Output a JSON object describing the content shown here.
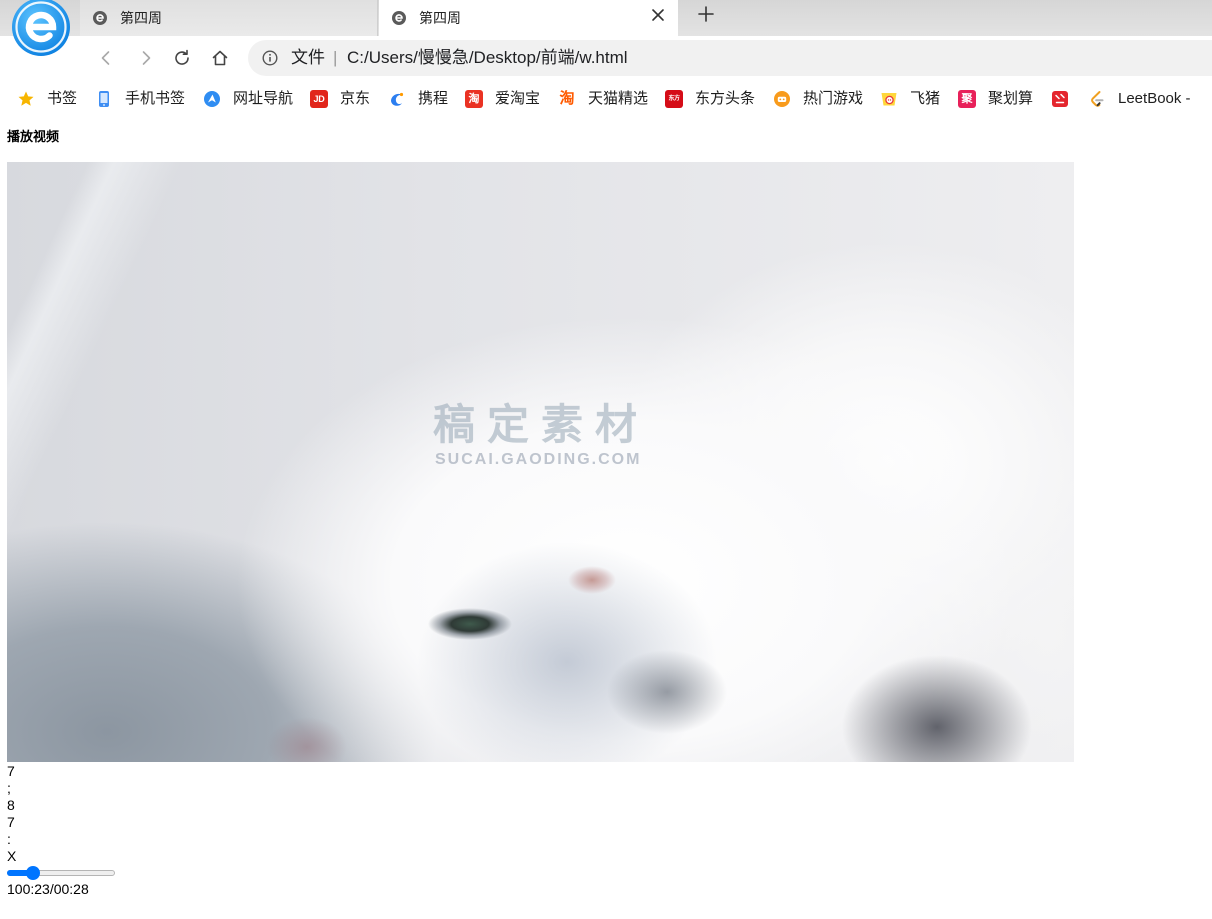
{
  "browser": {
    "logo": {
      "icon": "browser-logo-icon",
      "color": "#1890f0"
    },
    "tabs": [
      {
        "title": "第四周",
        "icon": "page-icon",
        "active": false
      },
      {
        "title": "第四周",
        "icon": "page-icon",
        "active": true,
        "close_icon": "close-icon"
      }
    ],
    "new_tab_icon": "plus-icon",
    "nav": {
      "back_icon": "back-arrow-icon",
      "forward_icon": "forward-arrow-icon",
      "reload_icon": "reload-icon",
      "home_icon": "home-icon"
    },
    "address": {
      "info_icon": "info-icon",
      "scheme_label": "文件",
      "separator": "|",
      "url": "C:/Users/慢慢急/Desktop/前端/w.html"
    },
    "bookmarks": [
      {
        "label": "书签",
        "icon": "star-icon",
        "color": "#f7b500"
      },
      {
        "label": "手机书签",
        "icon": "mobile-bookmark-icon",
        "color": "#3f8ef3"
      },
      {
        "label": "网址导航",
        "icon": "web-navigation-icon",
        "color": "#2f8df2"
      },
      {
        "label": "京东",
        "icon": "jd-icon",
        "icon_text": "JD",
        "color": "#e1251b"
      },
      {
        "label": "携程",
        "icon": "ctrip-icon",
        "color": "#2c7ef0"
      },
      {
        "label": "爱淘宝",
        "icon": "aitaobao-icon",
        "icon_text": "淘",
        "color": "#ea3223"
      },
      {
        "label": "天猫精选",
        "icon": "tmall-icon",
        "icon_text": "淘",
        "color": "#ff5a00"
      },
      {
        "label": "东方头条",
        "icon": "eastday-icon",
        "icon_text": "东方",
        "color": "#d50c17"
      },
      {
        "label": "热门游戏",
        "icon": "games-icon",
        "color": "#f89b1c"
      },
      {
        "label": "飞猪",
        "icon": "fliggy-icon",
        "color": "#ffd73b"
      },
      {
        "label": "聚划算",
        "icon": "juhuasuan-icon",
        "icon_text": "聚",
        "color": "#e8215a"
      },
      {
        "icon": "red-bookmark-icon",
        "color": "#e4262e"
      },
      {
        "label": "LeetBook -",
        "icon": "leetbook-icon",
        "color": "#f0a020"
      }
    ]
  },
  "page": {
    "heading": "播放视频",
    "video": {
      "watermark": {
        "title": "稿定素材",
        "url": "SUCAI.GAODING.COM"
      }
    },
    "controls": [
      "7",
      ";",
      "8",
      "7",
      ":",
      "X"
    ],
    "slider": {
      "fill_percent": 20,
      "accent_color": "#0075ff"
    },
    "time_text": "100:23/00:28"
  }
}
